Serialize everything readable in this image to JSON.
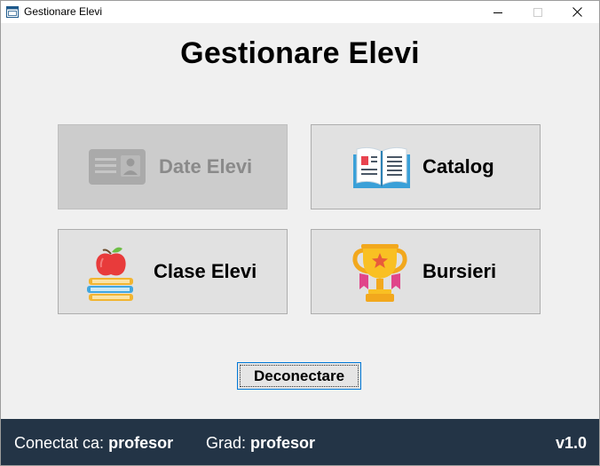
{
  "window": {
    "title": "Gestionare Elevi"
  },
  "heading": "Gestionare Elevi",
  "tiles": [
    {
      "label": "Date Elevi",
      "icon": "id-card-icon",
      "enabled": false
    },
    {
      "label": "Catalog",
      "icon": "open-book-icon",
      "enabled": true
    },
    {
      "label": "Clase Elevi",
      "icon": "apple-books-icon",
      "enabled": true
    },
    {
      "label": "Bursieri",
      "icon": "trophy-icon",
      "enabled": true
    }
  ],
  "logout_label": "Deconectare",
  "status": {
    "connected_label": "Conectat ca:",
    "connected_value": "profesor",
    "grade_label": "Grad:",
    "grade_value": "profesor",
    "version": "v1.0"
  },
  "colors": {
    "status_bg": "#233446",
    "focus_border": "#0078d7",
    "tile_bg": "#e1e1e1",
    "tile_disabled_bg": "#cccccc"
  }
}
